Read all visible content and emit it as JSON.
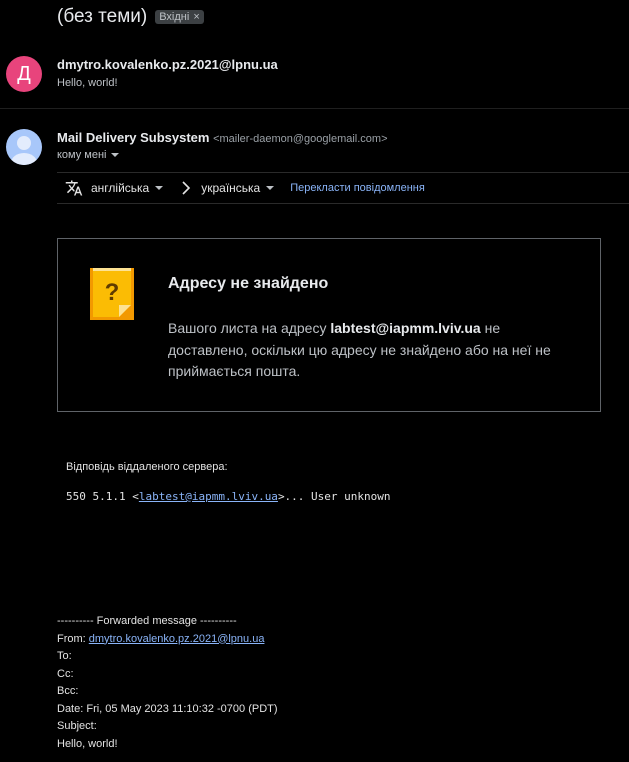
{
  "header": {
    "subject": "(без теми)",
    "label": "Вхідні",
    "label_remove": "×"
  },
  "message1": {
    "avatar_letter": "Д",
    "sender": "dmytro.kovalenko.pz.2021@lpnu.ua",
    "snippet": "Hello, world!",
    "avatar_color": "#e8447c"
  },
  "message2": {
    "sender_name": "Mail Delivery Subsystem",
    "sender_email": "<mailer-daemon@googlemail.com>",
    "to_me": "кому мені",
    "avatar_icon": "person-icon"
  },
  "translate_bar": {
    "icon": "translate-icon",
    "from_lang": "англійська",
    "to_lang": "українська",
    "translate_link": "Перекласти повідомлення"
  },
  "bounce_card": {
    "icon": "warning-note-icon",
    "title": "Адресу не знайдено",
    "body_prefix": "Вашого листа на адресу ",
    "address": "labtest@iapmm.lviv.ua",
    "body_suffix": " не доставлено, оскільки цю адресу не знайдено або на неї не приймається пошта."
  },
  "server_reply": {
    "label": "Відповідь віддаленого сервера:",
    "code_prefix": "550 5.1.1 <",
    "code_link": "labtest@iapmm.lviv.ua",
    "code_suffix": ">... User unknown"
  },
  "forwarded": {
    "header": "---------- Forwarded message ----------",
    "from_label": "From: ",
    "from_value": "dmytro.kovalenko.pz.2021@lpnu.ua",
    "to": "To:",
    "cc": "Cc:",
    "bcc": "Bcc:",
    "date": "Date: Fri, 05 May 2023 11:10:32 -0700 (PDT)",
    "subject": "Subject:",
    "body": "Hello, world!"
  },
  "colors": {
    "background": "#000000",
    "link": "#8ab4f8",
    "bounce_icon": "#f9ab00"
  }
}
